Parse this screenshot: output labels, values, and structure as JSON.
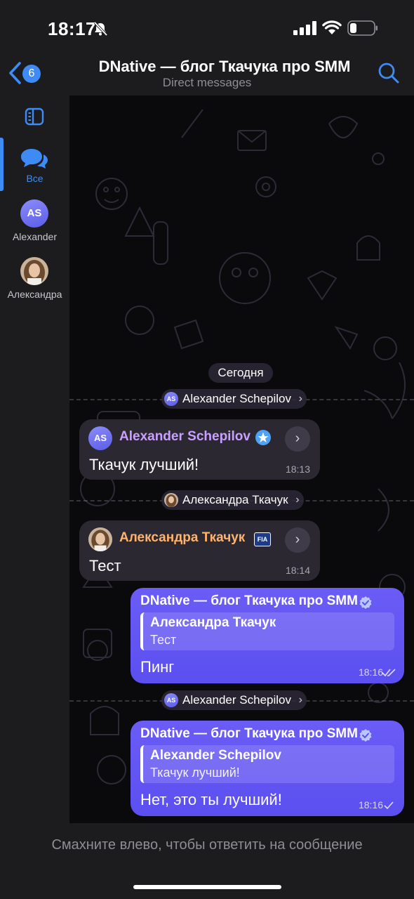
{
  "status": {
    "time": "18:17"
  },
  "header": {
    "back_count": "6",
    "title": "DNative — блог Ткачука про SMM",
    "subtitle": "Direct messages"
  },
  "sidebar": {
    "all_label": "Все",
    "users": [
      {
        "initials": "AS",
        "label": "Alexander"
      },
      {
        "label": "Александра"
      }
    ]
  },
  "chat": {
    "date": "Сегодня",
    "messages": [
      {
        "pill_initials": "AS",
        "pill_name": "Alexander Schepilov",
        "avatar_initials": "AS",
        "sender": "Alexander Schepilov",
        "sender_color": "#c9a0ff",
        "text": "Ткачук лучший!",
        "time": "18:13"
      },
      {
        "pill_name": "Александра Ткачук",
        "sender": "Александра Ткачук",
        "sender_color": "#ffb36b",
        "badge": "FIA",
        "text": "Тест",
        "time": "18:14"
      },
      {
        "sender": "DNative — блог Ткачука про SMM",
        "quote_name": "Александра Ткачук",
        "quote_text": "Тест",
        "text": "Пинг",
        "time": "18:16"
      },
      {
        "pill_initials": "AS",
        "pill_name": "Alexander Schepilov",
        "sender": "DNative — блог Ткачука про SMM",
        "quote_name": "Alexander Schepilov",
        "quote_text": "Ткачук лучший!",
        "text": "Нет, это ты лучший!",
        "time": "18:16"
      }
    ]
  },
  "footer": {
    "hint": "Смахните влево, чтобы ответить на сообщение"
  },
  "colors": {
    "accent": "#3e8bf5",
    "outgoing": "#5f53f3",
    "incoming": "#2c2832"
  }
}
